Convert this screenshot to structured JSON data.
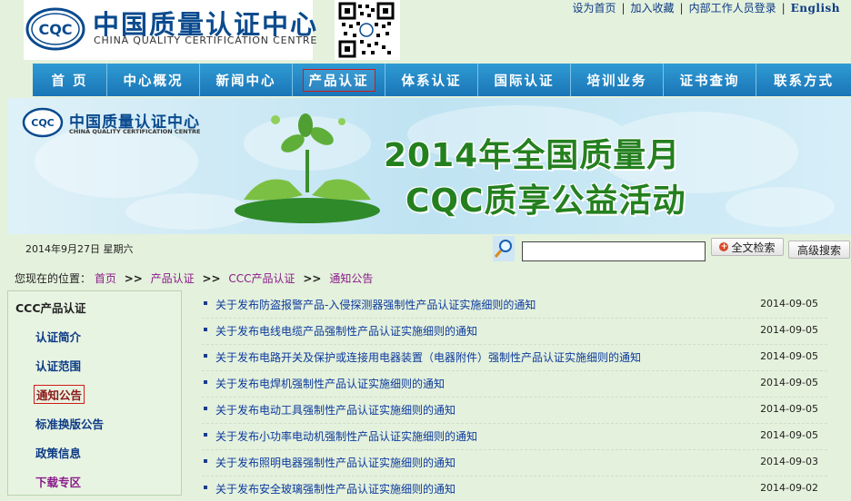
{
  "header": {
    "logo_cn": "中国质量认证中心",
    "logo_en": "CHINA QUALITY CERTIFICATION CENTRE",
    "logo_mark": "CQC",
    "top_links": [
      "设为首页",
      "加入收藏",
      "内部工作人员登录",
      "English"
    ]
  },
  "nav": {
    "items": [
      {
        "label": "首 页",
        "width": 82
      },
      {
        "label": "中心概况",
        "width": 102
      },
      {
        "label": "新闻中心",
        "width": 102
      },
      {
        "label": "产品认证",
        "width": 102,
        "active": true
      },
      {
        "label": "体系认证",
        "width": 102
      },
      {
        "label": "国际认证",
        "width": 102
      },
      {
        "label": "培训业务",
        "width": 102
      },
      {
        "label": "证书查询",
        "width": 102
      },
      {
        "label": "联系方式",
        "width": 104
      }
    ]
  },
  "banner": {
    "logo_cn": "中国质量认证中心",
    "logo_en": "CHINA QUALITY CERTIFICATION CENTRE",
    "headline_1": "2014年全国质量月",
    "headline_2": "CQC质享公益活动"
  },
  "date_text": "2014年9月27日  星期六",
  "search": {
    "fulltext_label": "全文检索",
    "advanced_label": "高级搜索"
  },
  "breadcrumb": {
    "prefix": "您现在的位置：",
    "items": [
      "首页",
      "产品认证",
      "CCC产品认证",
      "通知公告"
    ]
  },
  "sidebar": {
    "title": "CCC产品认证",
    "items": [
      "认证简介",
      "认证范围",
      "通知公告",
      "标准换版公告",
      "政策信息",
      "下载专区"
    ]
  },
  "news": [
    {
      "title": "关于发布防盗报警产品-入侵探测器强制性产品认证实施细则的通知",
      "date": "2014-09-05"
    },
    {
      "title": "关于发布电线电缆产品强制性产品认证实施细则的通知",
      "date": "2014-09-05"
    },
    {
      "title": "关于发布电路开关及保护或连接用电器装置（电器附件）强制性产品认证实施细则的通知",
      "date": "2014-09-05"
    },
    {
      "title": "关于发布电焊机强制性产品认证实施细则的通知",
      "date": "2014-09-05"
    },
    {
      "title": "关于发布电动工具强制性产品认证实施细则的通知",
      "date": "2014-09-05"
    },
    {
      "title": "关于发布小功率电动机强制性产品认证实施细则的通知",
      "date": "2014-09-05"
    },
    {
      "title": "关于发布照明电器强制性产品认证实施细则的通知",
      "date": "2014-09-03"
    },
    {
      "title": "关于发布安全玻璃强制性产品认证实施细则的通知",
      "date": "2014-09-02"
    }
  ],
  "colors": {
    "page_bg": "#e4f1dc",
    "nav_bg": "#1a75b6",
    "link_blue": "#0c3a9e",
    "active_red": "#d01a1a"
  }
}
